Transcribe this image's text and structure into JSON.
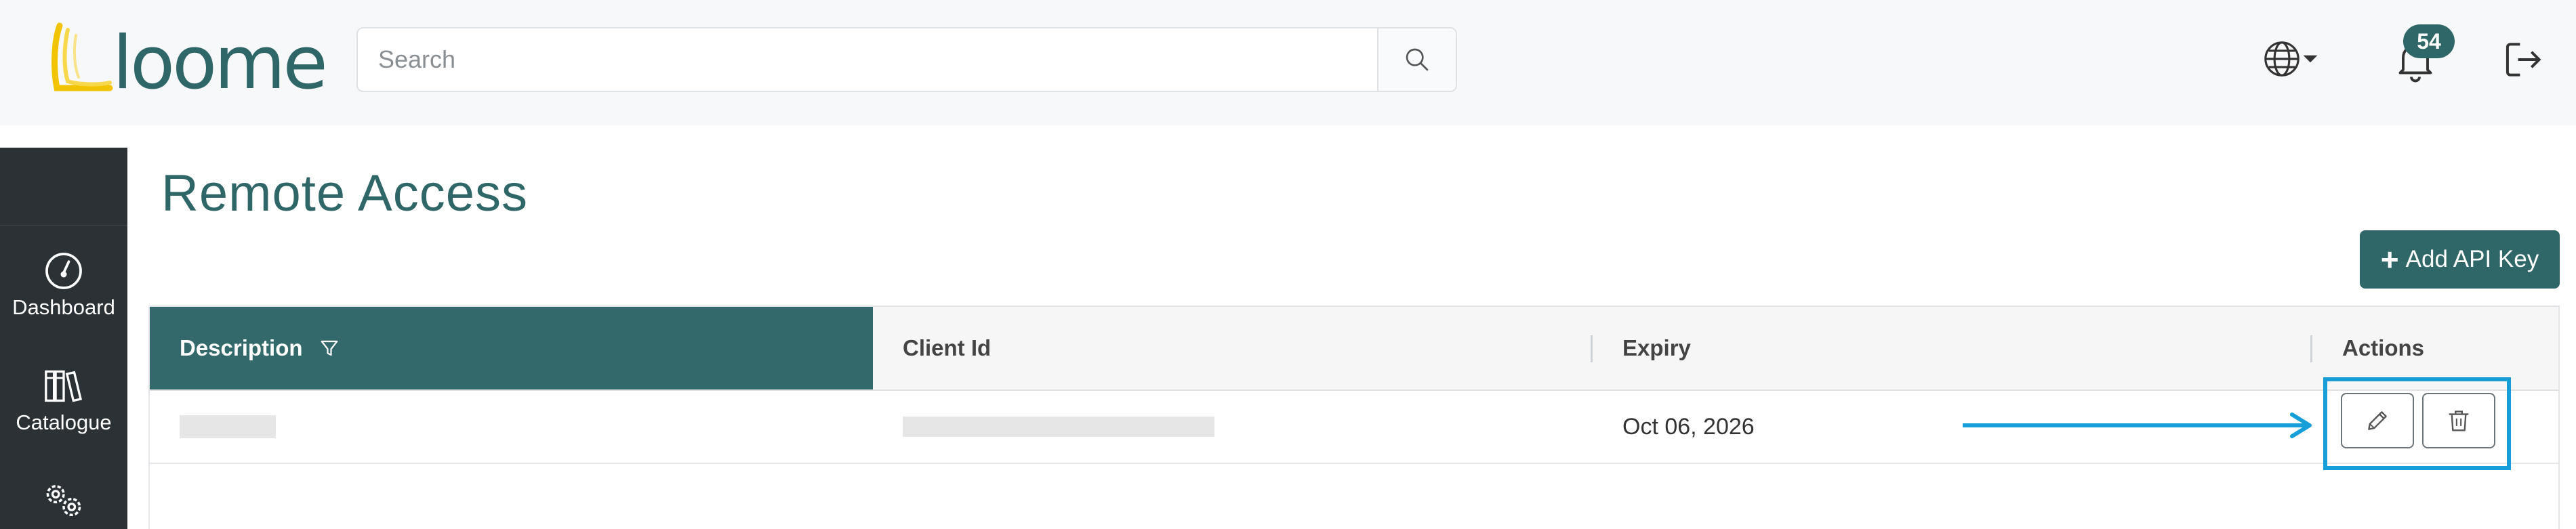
{
  "header": {
    "logo_text": "loome",
    "search": {
      "placeholder": "Search",
      "value": ""
    },
    "notification_count": "54"
  },
  "sidebar": {
    "items": [
      {
        "label": "Dashboard",
        "icon": "gauge-icon"
      },
      {
        "label": "Catalogue",
        "icon": "books-icon"
      },
      {
        "label": "",
        "icon": "gears-icon"
      }
    ]
  },
  "page": {
    "title": "Remote Access",
    "add_button_label": "Add API Key"
  },
  "table": {
    "columns": [
      "Description",
      "Client Id",
      "Expiry",
      "Actions"
    ],
    "rows": [
      {
        "description": "",
        "client_id": "",
        "expiry": "Oct 06, 2026"
      }
    ]
  },
  "colors": {
    "accent": "#2f6768",
    "sidebar": "#2c3136",
    "highlight": "#169ed8",
    "logo_yellow": "#f2c400"
  }
}
